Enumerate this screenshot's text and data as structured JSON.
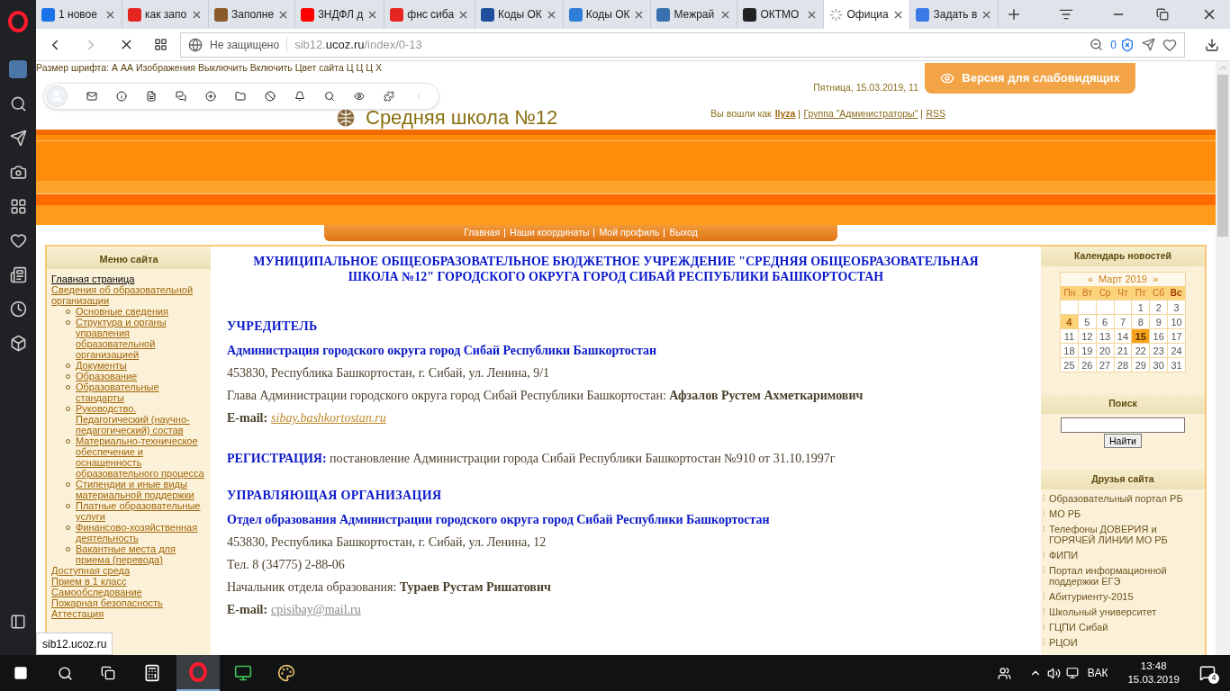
{
  "browser": {
    "tabs": [
      {
        "title": "1 новое",
        "color": "#1a73e8",
        "selected": false,
        "loading": false
      },
      {
        "title": "как запо",
        "color": "#e52620",
        "selected": false,
        "loading": false
      },
      {
        "title": "Заполне",
        "color": "#8a5a2b",
        "selected": false,
        "loading": false
      },
      {
        "title": "3НДФЛ д",
        "color": "#ff0000",
        "selected": false,
        "loading": false
      },
      {
        "title": "фнс сиба",
        "color": "#e52620",
        "selected": false,
        "loading": false
      },
      {
        "title": "Коды ОК",
        "color": "#1f4f9c",
        "selected": false,
        "loading": false
      },
      {
        "title": "Коды ОК",
        "color": "#2f7ed8",
        "selected": false,
        "loading": false
      },
      {
        "title": "Межрай",
        "color": "#3a6fb0",
        "selected": false,
        "loading": false
      },
      {
        "title": "ОКТМО",
        "color": "#222222",
        "selected": false,
        "loading": false
      },
      {
        "title": "Официа",
        "selected": true,
        "loading": true
      },
      {
        "title": "Задать в",
        "color": "#3b7be8",
        "selected": false,
        "loading": false
      }
    ],
    "security": "Не защищено",
    "url_prefix": "sib12.",
    "url_host": "ucoz.ru",
    "url_path": "/index/0-13",
    "blocked_count": "0",
    "status_tooltip": "sib12.ucoz.ru"
  },
  "accessibility_bar": [
    "Размер шрифта:",
    "А",
    "АА",
    "Изображения",
    "Выключить",
    "Включить",
    "Цвет сайта",
    "Ц",
    "Ц",
    "Ц",
    "Х"
  ],
  "header": {
    "site_title": "Средняя школа №12",
    "date": "Пятница, 15.03.2019, 11",
    "login_prefix": "Вы вошли как",
    "user": "Ilyza",
    "group": "Группа \"Администраторы\"",
    "rss": "RSS",
    "low_vision_button": "Версия для слабовидящих"
  },
  "nav": [
    "Главная",
    "Наши координаты",
    "Мой профиль",
    "Выход"
  ],
  "left_menu": {
    "title": "Меню сайта",
    "items": [
      {
        "label": "Главная страница",
        "current": true
      },
      {
        "label": "Сведения об образовательной организации",
        "current": false,
        "children": [
          {
            "label": "Основные сведения"
          },
          {
            "label": "Структура и органы управления образовательной организацией"
          },
          {
            "label": "Документы"
          },
          {
            "label": "Образование"
          },
          {
            "label": "Образовательные стандарты"
          },
          {
            "label": "Руководство. Педагогический (научно-педагогический) состав"
          },
          {
            "label": "Материально-техническое обеспечение и оснащенность образовательного процесса"
          },
          {
            "label": "Стипендии и иные виды материальной поддержки"
          },
          {
            "label": "Платные образовательные услуги"
          },
          {
            "label": "Финансово-хозяйственная деятельность"
          },
          {
            "label": "Вакантные места для приема (перевода)"
          }
        ]
      },
      {
        "label": "Доступная среда",
        "current": false
      },
      {
        "label": "Прием в 1 класс",
        "current": false
      },
      {
        "label": "Самообследование",
        "current": false
      },
      {
        "label": "Пожарная безопасность",
        "current": false
      },
      {
        "label": "Аттестация",
        "current": false
      }
    ]
  },
  "content": [
    {
      "kind": "title",
      "text": "МУНИЦИПАЛЬНОЕ ОБЩЕОБРАЗОВАТЕЛЬНОЕ БЮДЖЕТНОЕ УЧРЕЖДЕНИЕ \"СРЕДНЯЯ ОБЩЕОБРАЗОВАТЕЛЬНАЯ ШКОЛА №12\" ГОРОДСКОГО ОКРУГА ГОРОД СИБАЙ РЕСПУБЛИКИ БАШКОРТОСТАН"
    },
    {
      "kind": "heading",
      "text": "УЧРЕДИТЕЛЬ"
    },
    {
      "kind": "subheading",
      "text": "Администрация городского округа город Сибай Республики Башкортостан"
    },
    {
      "kind": "text",
      "text": "453830, Республика Башкортостан, г. Сибай, ул. Ленина, 9/1"
    },
    {
      "kind": "text",
      "text": "Глава Администрации  городского округа город Сибай Республики Башкортостан: **Афзалов Рустем Ахметкаримович**"
    },
    {
      "kind": "email",
      "label": "E-mail:",
      "link": "sibay.bashkortostan.ru",
      "italic": true
    },
    {
      "kind": "registration",
      "label": "РЕГИСТРАЦИЯ:",
      "text": "постановление Администрации города Сибай Республики Башкортостан №910 от 31.10.1997г"
    },
    {
      "kind": "heading",
      "text": "УПРАВЛЯЮЩАЯ ОРГАНИЗАЦИЯ"
    },
    {
      "kind": "subheading",
      "text": "Отдел образования Администрации городского округа город Сибай Республики Башкортостан"
    },
    {
      "kind": "text",
      "text": "453830, Республика Башкортостан, г. Сибай, ул. Ленина, 12"
    },
    {
      "kind": "text",
      "text": "Тел. 8 (34775) 2-88-06"
    },
    {
      "kind": "text",
      "text": "Начальник отдела образования: **Тураев Рустам Ришатович**"
    },
    {
      "kind": "email",
      "label": "E-mail:",
      "link": "cpisibay@mail.ru",
      "italic": false
    }
  ],
  "calendar": {
    "title": "Календарь новостей",
    "prev": "«",
    "month": "Март 2019",
    "next": "»",
    "weekdays": [
      "Пн",
      "Вт",
      "Ср",
      "Чт",
      "Пт",
      "Сб",
      "Вс"
    ],
    "weeks": [
      [
        {
          "kind": "blank"
        },
        {
          "kind": "blank"
        },
        {
          "kind": "blank"
        },
        {
          "kind": "blank"
        },
        {
          "day": "1",
          "kind": "plain"
        },
        {
          "day": "2",
          "kind": "plain"
        },
        {
          "day": "3",
          "kind": "plain"
        }
      ],
      [
        {
          "day": "4",
          "kind": "news"
        },
        {
          "day": "5",
          "kind": "plain"
        },
        {
          "day": "6",
          "kind": "plain"
        },
        {
          "day": "7",
          "kind": "plain"
        },
        {
          "day": "8",
          "kind": "plain"
        },
        {
          "day": "9",
          "kind": "plain"
        },
        {
          "day": "10",
          "kind": "plain"
        }
      ],
      [
        {
          "day": "11",
          "kind": "plain"
        },
        {
          "day": "12",
          "kind": "plain"
        },
        {
          "day": "13",
          "kind": "plain"
        },
        {
          "day": "14",
          "kind": "plain"
        },
        {
          "day": "15",
          "kind": "today"
        },
        {
          "day": "16",
          "kind": "plain"
        },
        {
          "day": "17",
          "kind": "plain"
        }
      ],
      [
        {
          "day": "18",
          "kind": "plain"
        },
        {
          "day": "19",
          "kind": "plain"
        },
        {
          "day": "20",
          "kind": "plain"
        },
        {
          "day": "21",
          "kind": "plain"
        },
        {
          "day": "22",
          "kind": "plain"
        },
        {
          "day": "23",
          "kind": "plain"
        },
        {
          "day": "24",
          "kind": "plain"
        }
      ],
      [
        {
          "day": "25",
          "kind": "plain"
        },
        {
          "day": "26",
          "kind": "plain"
        },
        {
          "day": "27",
          "kind": "plain"
        },
        {
          "day": "28",
          "kind": "plain"
        },
        {
          "day": "29",
          "kind": "plain"
        },
        {
          "day": "30",
          "kind": "plain"
        },
        {
          "day": "31",
          "kind": "plain"
        }
      ]
    ]
  },
  "search": {
    "title": "Поиск",
    "button": "Найти"
  },
  "friends": {
    "title": "Друзья сайта",
    "links": [
      "Образовательный портал РБ",
      "МО РБ",
      "Телефоны ДОВЕРИЯ и ГОРЯЧЕЙ ЛИНИИ МО РБ",
      "ФИПИ",
      "Портал информационной поддержки ЕГЭ",
      "Абитуриенту-2015",
      "Школьный университет",
      "ГЦПИ Сибай",
      "РЦОИ"
    ]
  },
  "taskbar": {
    "language": "ВАК",
    "time": "13:48",
    "date": "15.03.2019",
    "notifications": "4"
  }
}
